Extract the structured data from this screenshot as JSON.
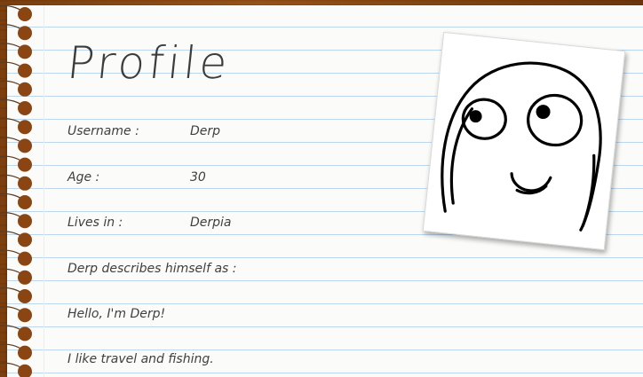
{
  "page": {
    "title": "Profile"
  },
  "profile": {
    "fields": [
      {
        "label": "Username :",
        "value": "Derp"
      },
      {
        "label": "Age :",
        "value": "30"
      },
      {
        "label": "Lives in :",
        "value": "Derpia"
      }
    ],
    "describes_label": "Derp describes himself as :",
    "bio_lines": [
      "Hello, I'm Derp!",
      "I like travel and fishing."
    ]
  },
  "photo": {
    "icon": "derp-face-icon"
  },
  "colors": {
    "paper": "#fbfcf9",
    "rule_line": "#bcd7ec",
    "ink": "#3f3f3f",
    "wood": "#8a4a12",
    "spiral_hole": "#8b4513"
  }
}
